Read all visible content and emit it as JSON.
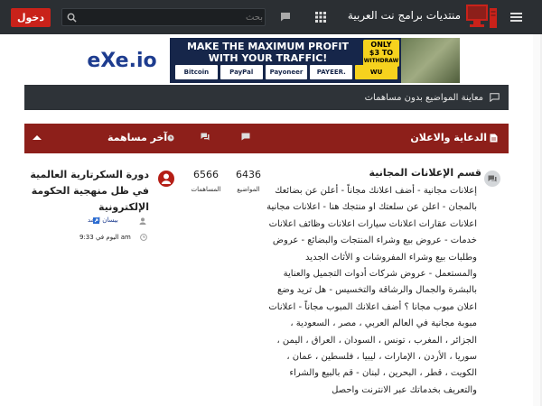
{
  "header": {
    "site_title": "منتديات برامج نت العربية",
    "login_label": "دخول",
    "search_placeholder": "بحث"
  },
  "banner": {
    "brand": "eXe.io",
    "headline_line1": "MAKE THE MAXIMUM PROFIT",
    "headline_line2": "WITH YOUR TRAFFIC!",
    "badge_line1": "ONLY",
    "badge_line2": "$3 TO",
    "badge_line3": "WITHDRAW",
    "payments": [
      "Bitcoin",
      "PayPal",
      "Payoneer",
      "PAYEER.",
      "WU"
    ]
  },
  "unanswered": {
    "label": "معاينة المواضيع بدون مساهمات"
  },
  "section": {
    "title": "الدعاية والاعلان",
    "last_post_label": "آخر مساهمة"
  },
  "forum": {
    "title": "قسم الإعلانات المجانية",
    "description": "إعلانات مجانية - أضف اعلانك مجاناً - أعلن عن بضائعك بالمجان - اعلن عن سلعتك او منتجك هنا - اعلانات مجانية اعلانات عقارات اعلانات سيارات اعلانات وظائف اعلانات خدمات - عروض بيع وشراء المنتجات والبضائع - عروض وطلبات بيع وشراء المفروشات و الأثاث الجديد والمستعمل - عروض شركات أدوات التجميل والعناية بالبشرة والجمال والرشاقة والتخسيس - هل تريد وضع اعلان مبوب مجانا ؟ أضف اعلانك المبوب مجاناً - اعلانات مبوبة مجانية في العالم العربي ، مصر ، السعودية ، الجزائر ، المغرب ، تونس ، السودان ، العراق ، اليمن ، سوريا ، الأردن ، الإمارات ، ليبيا ، فلسطين ، عمان ، الكويت ، قطر ، البحرين ، لبنان - قم بالبيع والشراء والتعريف بخدماتك عبر الانترنت واحصل",
    "topics_count": "6436",
    "topics_label": "المواضيع",
    "posts_count": "6566",
    "posts_label": "المساهمات",
    "last_post": {
      "title": "دورة السكرتارية العالمية في ظل منهجية الحكومة الإلكترونية",
      "author": "بيسان احمد",
      "time": "اليوم في 9:33 am"
    }
  },
  "colors": {
    "topbar": "#2b2f33",
    "accent_red": "#c9221a",
    "section_header": "#8d1f1a",
    "bar_dark": "#2e3338"
  }
}
